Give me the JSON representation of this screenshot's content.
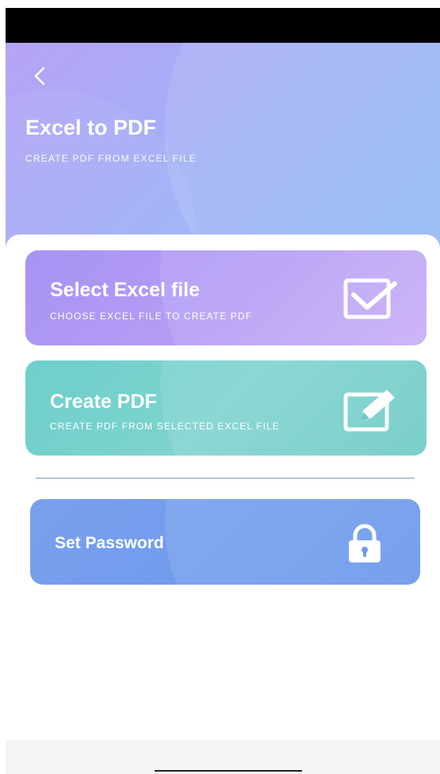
{
  "header": {
    "back_icon": "chevron-left-icon",
    "title": "Excel to PDF",
    "subtitle": "CREATE PDF FROM EXCEL FILE"
  },
  "cards": {
    "select": {
      "title": "Select Excel file",
      "subtitle": "CHOOSE EXCEL FILE TO CREATE PDF",
      "icon": "checkbox-icon",
      "color": "#b09af5"
    },
    "create": {
      "title": "Create PDF",
      "subtitle": "CREATE PDF FROM SELECTED EXCEL FILE",
      "icon": "edit-pencil-icon",
      "color": "#77d0cb"
    },
    "password": {
      "title": "Set Password",
      "icon": "lock-icon",
      "color": "#72a0ec"
    }
  }
}
